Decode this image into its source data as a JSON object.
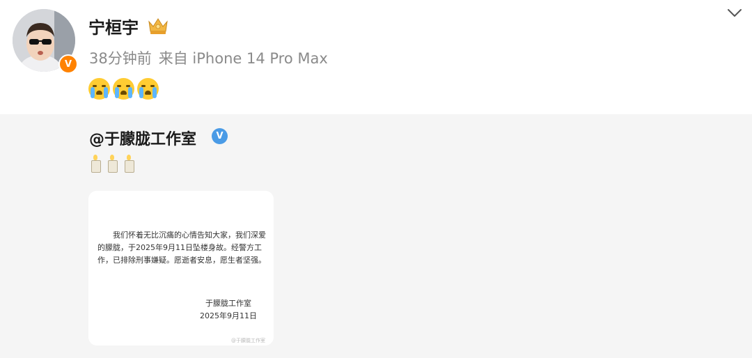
{
  "post": {
    "author": "宁桓宇",
    "time": "38分钟前",
    "source": "来自 iPhone 14 Pro Max",
    "emojis": [
      "loudly-crying-emoji",
      "loudly-crying-emoji",
      "loudly-crying-emoji"
    ],
    "verify_badge_color": "#ff8200"
  },
  "repost": {
    "mention": "@于朦胧工作室",
    "verify_badge_color": "#4a9be6",
    "emojis": [
      "candle-emoji",
      "candle-emoji",
      "candle-emoji"
    ],
    "statement": {
      "body": "我们怀着无比沉痛的心情告知大家，我们深爱的朦胧，于2025年9月11日坠楼身故。经警方工作，已排除刑事嫌疑。愿逝者安息，愿生者坚强。",
      "signature": "于朦胧工作室",
      "date": "2025年9月11日",
      "watermark": "@于朦胧工作室"
    }
  },
  "colors": {
    "repost_background": "#f5f5f5",
    "meta_text": "#8a8a8a"
  }
}
